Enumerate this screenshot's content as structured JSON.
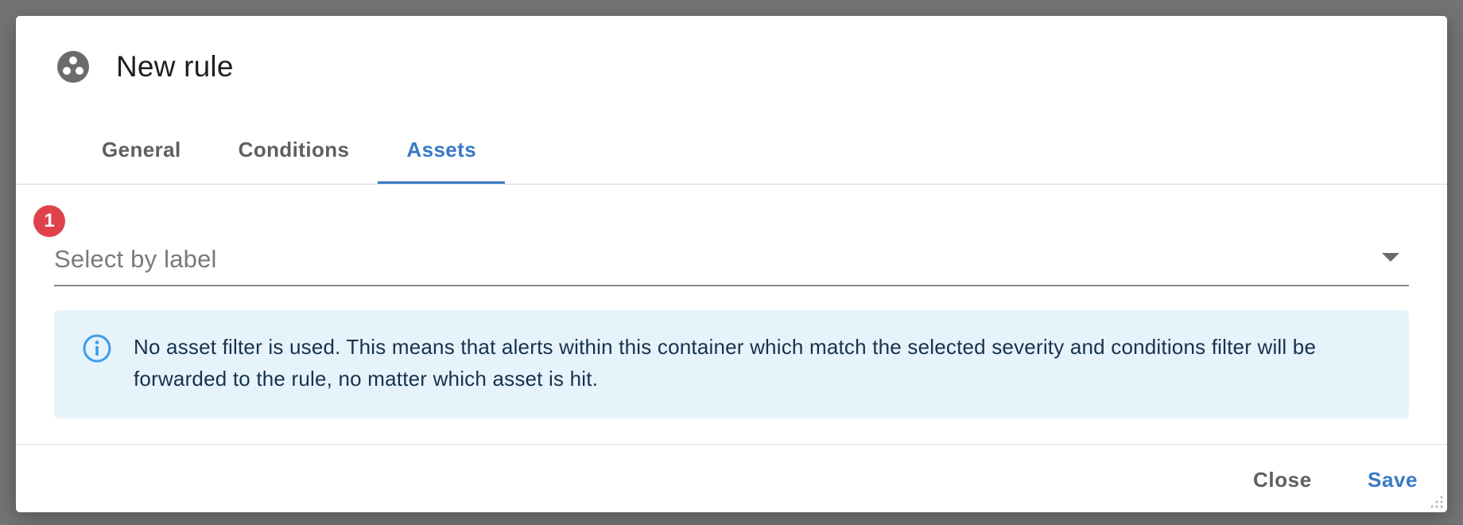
{
  "dialog": {
    "title": "New rule",
    "title_icon": "rule-group-icon"
  },
  "tabs": [
    {
      "label": "General",
      "active": false
    },
    {
      "label": "Conditions",
      "active": false
    },
    {
      "label": "Assets",
      "active": true
    }
  ],
  "assets": {
    "badge_count": "1",
    "select_placeholder": "Select by label",
    "info_icon": "info-icon",
    "info_text": "No asset filter is used. This means that alerts within this container which match the selected severity and conditions filter will be forwarded to the rule, no matter which asset is hit."
  },
  "footer": {
    "close_label": "Close",
    "save_label": "Save"
  },
  "colors": {
    "accent": "#3a78c7",
    "badge": "#e0424b",
    "info_background": "#e6f3fb"
  }
}
